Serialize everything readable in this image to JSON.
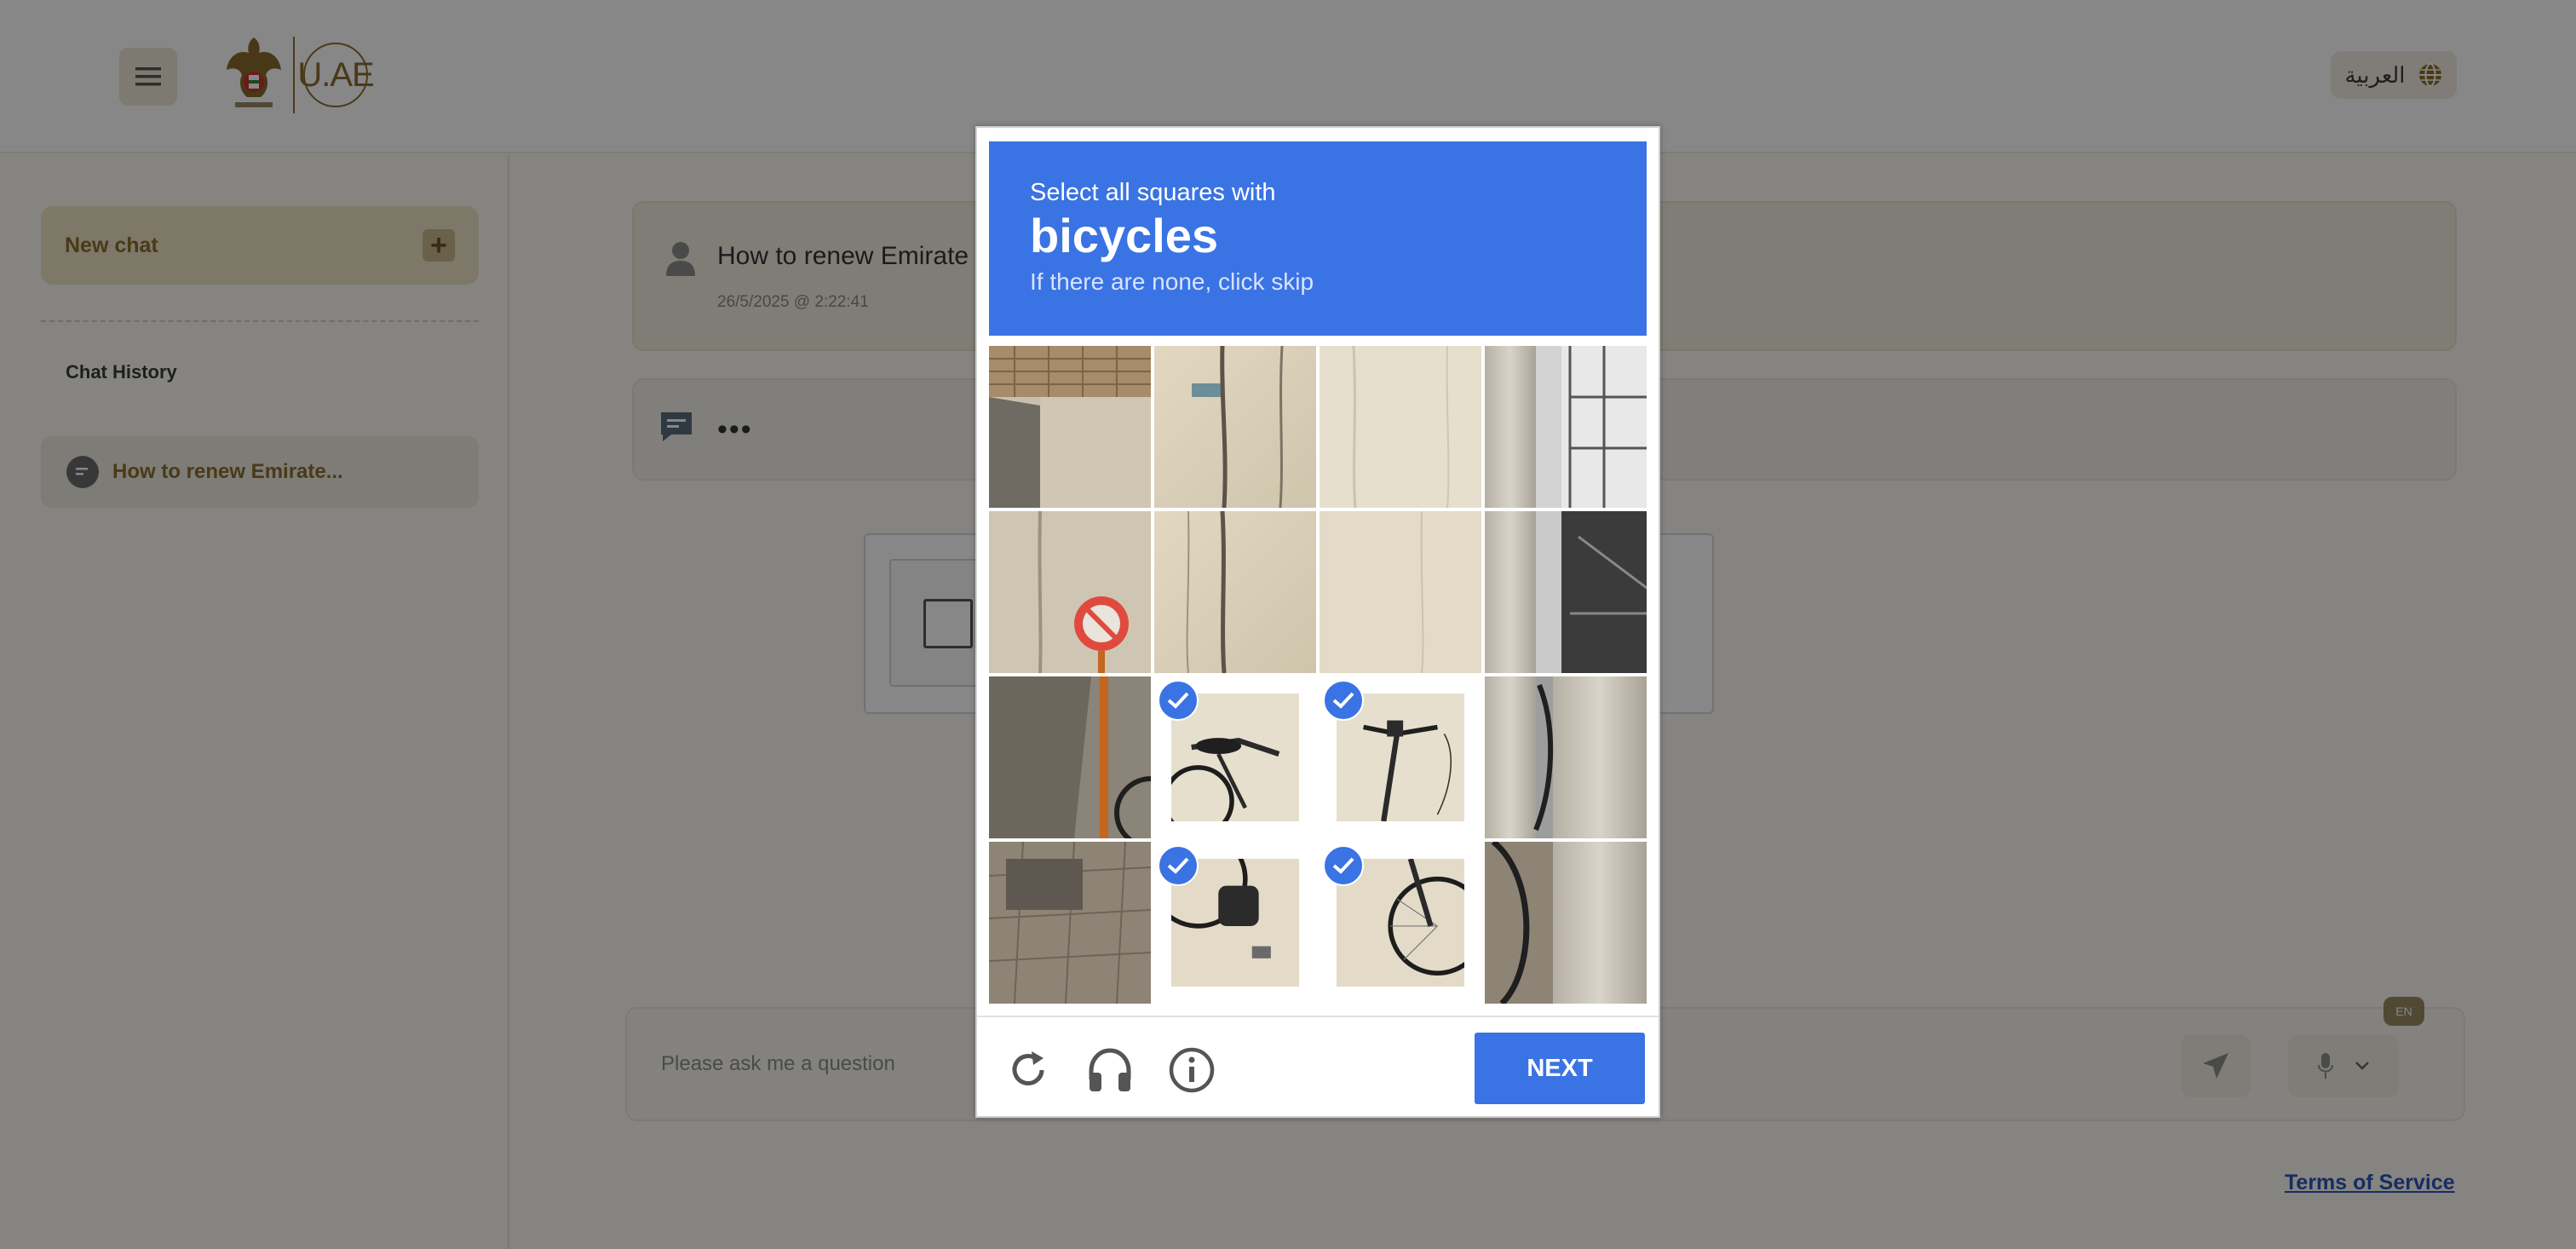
{
  "header": {
    "menu_icon": "hamburger-icon",
    "logo_text": "U.AE",
    "language_label": "العربية",
    "language_icon": "globe-icon"
  },
  "sidebar": {
    "new_chat_label": "New chat",
    "history_title": "Chat History",
    "history_items": [
      {
        "label": "How to renew Emirate..."
      }
    ]
  },
  "chat": {
    "user_message": "How to renew Emirate",
    "user_timestamp": "26/5/2025 @ 2:22:41",
    "bot_message": "•••",
    "input_placeholder": "Please ask me a question",
    "lang_badge": "EN"
  },
  "footer": {
    "terms_label": "Terms of Service"
  },
  "captcha": {
    "instruction_line1": "Select all squares with",
    "target_word": "bicycles",
    "instruction_line3": "If there are none, click skip",
    "next_label": "NEXT",
    "tiles": [
      {
        "selected": false
      },
      {
        "selected": false
      },
      {
        "selected": false
      },
      {
        "selected": false
      },
      {
        "selected": false
      },
      {
        "selected": false
      },
      {
        "selected": false
      },
      {
        "selected": false
      },
      {
        "selected": false
      },
      {
        "selected": true
      },
      {
        "selected": true
      },
      {
        "selected": false
      },
      {
        "selected": false
      },
      {
        "selected": true
      },
      {
        "selected": true
      },
      {
        "selected": false
      }
    ],
    "accent_color": "#3a73e3"
  }
}
